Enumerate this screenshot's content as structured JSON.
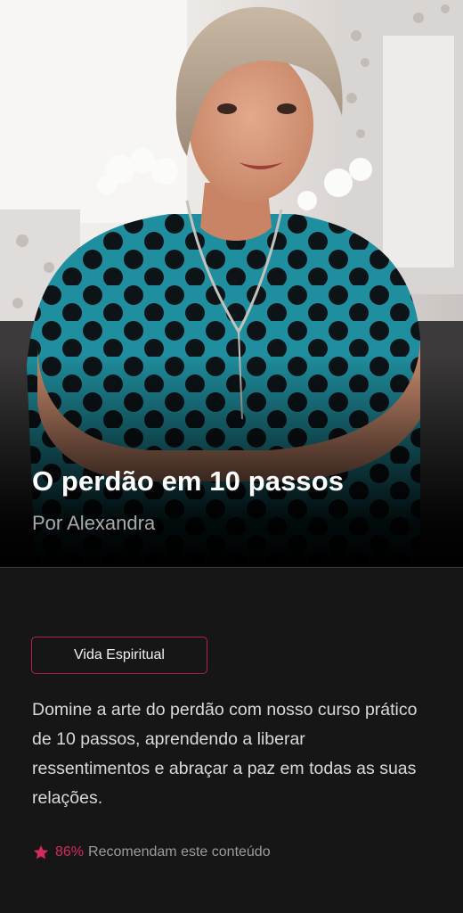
{
  "course": {
    "title": "O perdão em 10 passos",
    "author": "Por Alexandra",
    "category": "Vida Espiritual",
    "description": "Domine a arte do perdão com nosso curso prático de 10 passos, aprendendo a liberar ressentimentos e abraçar a paz em todas as suas relações.",
    "recommend_percent": "86%",
    "recommend_text": "Recomendam este conteúdo"
  },
  "colors": {
    "accent": "#d42a5c",
    "chip_border": "#b41f4a",
    "background": "#171617"
  },
  "icons": {
    "rating": "star-icon"
  }
}
